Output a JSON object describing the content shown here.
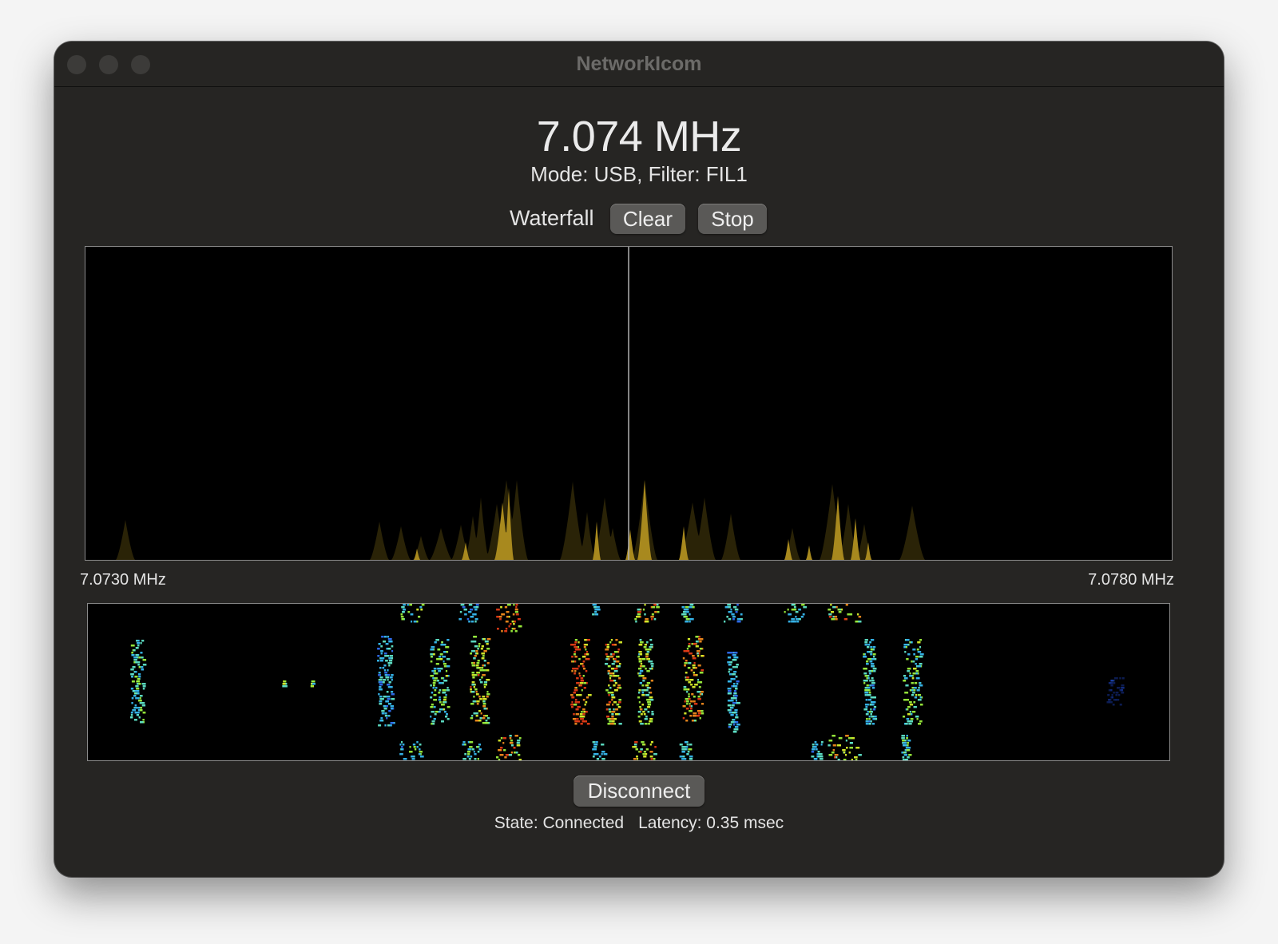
{
  "window": {
    "title": "NetworkIcom"
  },
  "header": {
    "frequency": "7.074 MHz",
    "mode_filter": "Mode: USB, Filter: FIL1"
  },
  "controls": {
    "waterfall_label": "Waterfall",
    "clear_label": "Clear",
    "stop_label": "Stop"
  },
  "spectrum": {
    "left_freq": "7.0730 MHz",
    "right_freq": "7.0780 MHz",
    "colors": {
      "peak": "#a8891e",
      "average": "#2a2307",
      "center_line": "#b0b0b0",
      "border": "#8a8a8a"
    }
  },
  "footer": {
    "disconnect_label": "Disconnect",
    "state": "State: Connected",
    "latency": "Latency: 0.35 msec"
  }
}
